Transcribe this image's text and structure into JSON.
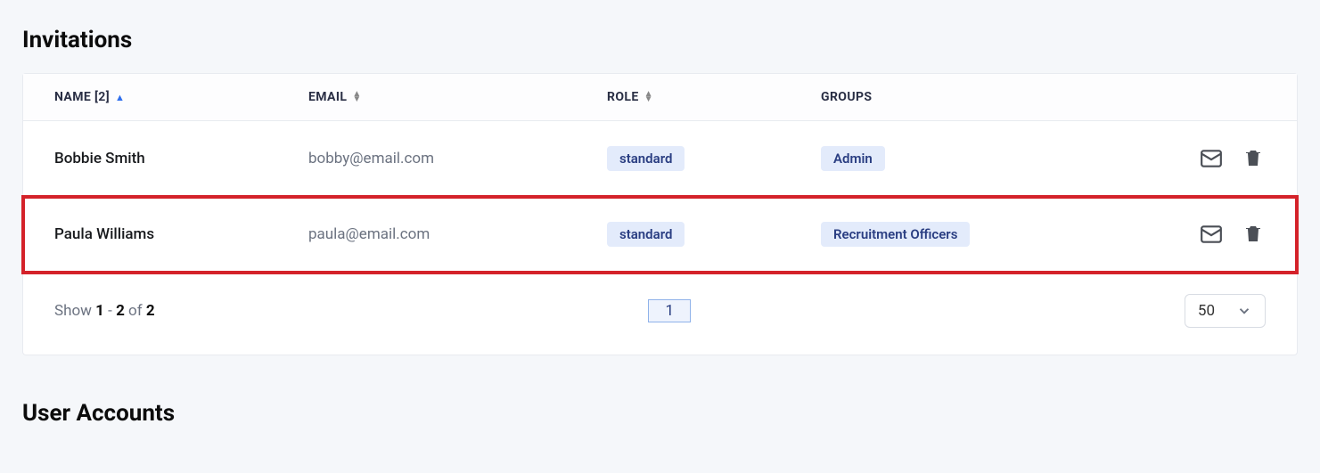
{
  "sections": {
    "invitations_title": "Invitations",
    "user_accounts_title": "User Accounts"
  },
  "columns": {
    "name": "NAME [2]",
    "email": "EMAIL",
    "role": "ROLE",
    "groups": "GROUPS"
  },
  "rows": [
    {
      "name": "Bobbie Smith",
      "email": "bobby@email.com",
      "role": "standard",
      "group": "Admin",
      "highlighted": false
    },
    {
      "name": "Paula Williams",
      "email": "paula@email.com",
      "role": "standard",
      "group": "Recruitment Officers",
      "highlighted": true
    }
  ],
  "footer": {
    "show_prefix": "Show ",
    "range_start": "1",
    "range_sep": " - ",
    "range_end": "2",
    "of_text": " of ",
    "total": "2",
    "current_page": "1",
    "page_size": "50"
  }
}
